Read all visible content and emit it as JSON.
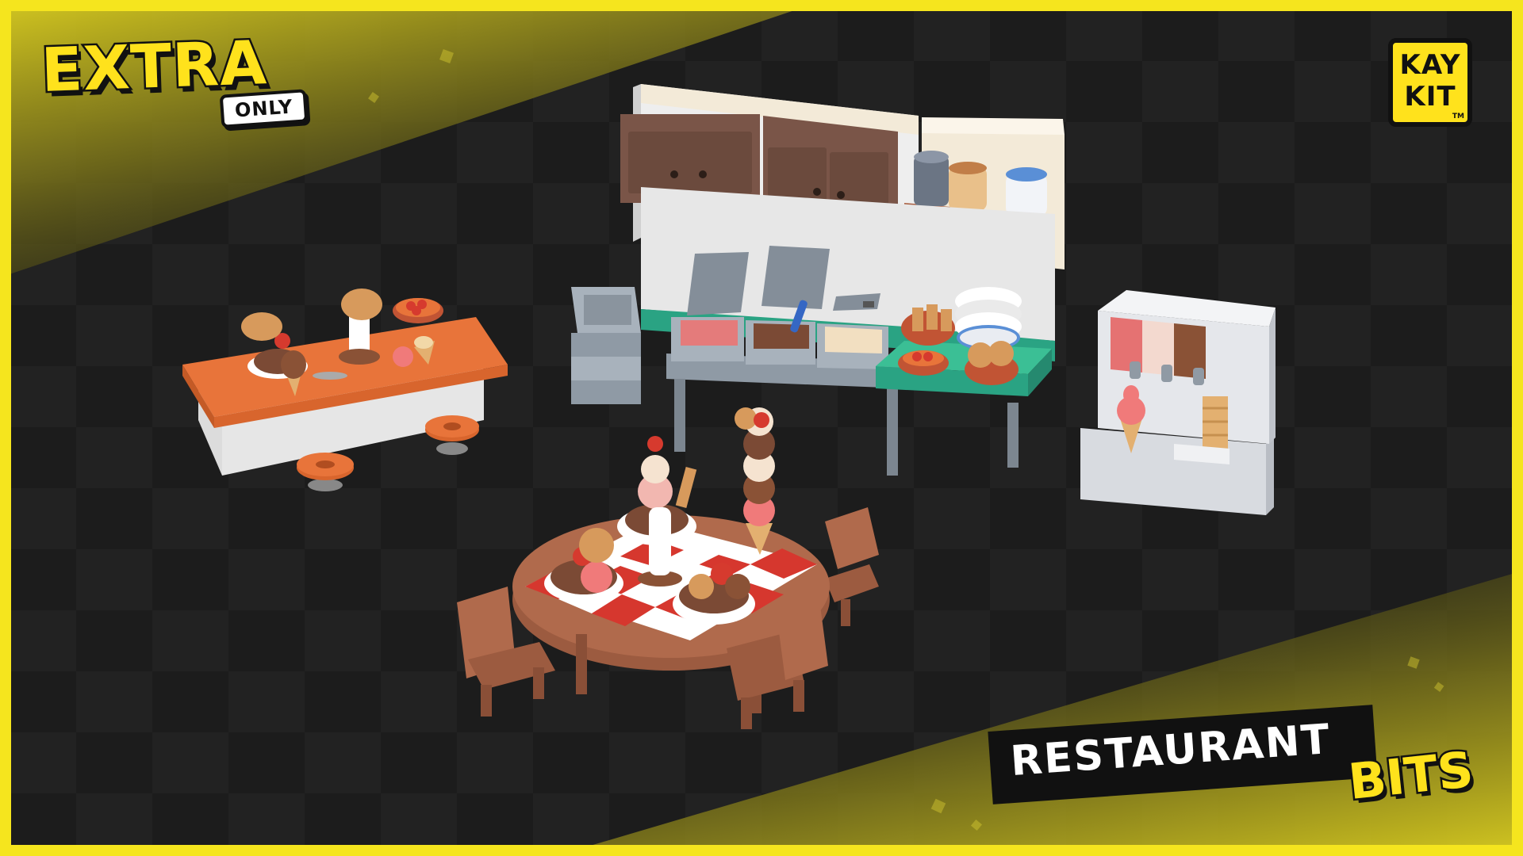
{
  "badge": {
    "extra_label": "EXTRA",
    "only_label": "ONLY"
  },
  "logo": {
    "line1": "KAY",
    "line2": "KIT",
    "trademark": "TM"
  },
  "title": {
    "main": "RESTAURANT",
    "accent": "BITS"
  },
  "colors": {
    "accent_yellow": "#ffe21c",
    "frame_yellow": "#f5e51e",
    "background_dark": "#1b1b1b",
    "counter_orange": "#e8743a",
    "wood_brown": "#b06a4c",
    "teal": "#2aa383",
    "checker_red": "#d6372e"
  },
  "icons": {
    "logo": "kaykit-logo-icon",
    "props": [
      "ice-cream-counter-icon",
      "kitchen-wall-icon",
      "soft-serve-machine-icon",
      "dining-table-icon"
    ]
  }
}
